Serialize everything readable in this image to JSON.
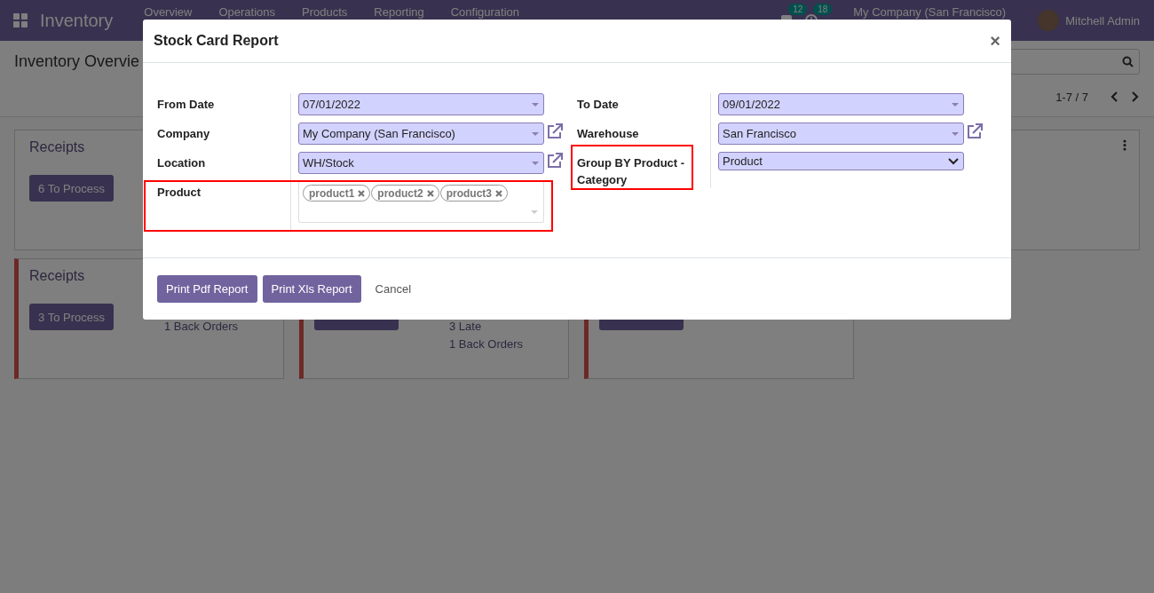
{
  "navbar": {
    "app_name": "Inventory",
    "menu": [
      "Overview",
      "Operations",
      "Products",
      "Reporting",
      "Configuration"
    ],
    "messages_count": "12",
    "activities_count": "18",
    "company": "My Company (San Francisco)",
    "user": "Mitchell Admin"
  },
  "control_panel": {
    "title": "Inventory Overvie",
    "pager": "1-7 / 7"
  },
  "card_rows": [
    {
      "cards": [
        {
          "title": "Receipts",
          "button": "6 To Process",
          "late": false
        },
        {
          "menu": true,
          "late": false
        }
      ]
    },
    {
      "cards": [
        {
          "title": "Receipts",
          "button": "3 To Process",
          "stats": [
            "1 Back Orders"
          ],
          "late": true
        },
        {
          "process_button": true,
          "stats": [
            "3 Late",
            "1 Back Orders"
          ],
          "late": true
        },
        {
          "process_button": true,
          "late": true
        }
      ]
    }
  ],
  "dialog": {
    "title": "Stock Card Report",
    "close": "×",
    "left_fields": [
      {
        "label": "From Date",
        "kind": "date",
        "value": "07/01/2022"
      },
      {
        "label": "Company",
        "kind": "many2one",
        "value": "My Company (San Francisco)",
        "external_link": true
      },
      {
        "label": "Location",
        "kind": "many2one",
        "value": "WH/Stock",
        "external_link": true
      },
      {
        "label": "Product",
        "kind": "tags",
        "tags": [
          "product1",
          "product2",
          "product3"
        ],
        "highlight_row": true
      }
    ],
    "right_fields": [
      {
        "label": "To Date",
        "kind": "date",
        "value": "09/01/2022"
      },
      {
        "label": "Warehouse",
        "kind": "many2one",
        "value": "San Francisco",
        "external_link": true
      },
      {
        "label": "Group BY Product - Category",
        "kind": "select",
        "value": "Product",
        "highlight_label": true
      }
    ],
    "buttons": [
      {
        "label": "Print Pdf Report",
        "kind": "primary"
      },
      {
        "label": "Print Xls Report",
        "kind": "primary"
      },
      {
        "label": "Cancel",
        "kind": "link"
      }
    ]
  }
}
